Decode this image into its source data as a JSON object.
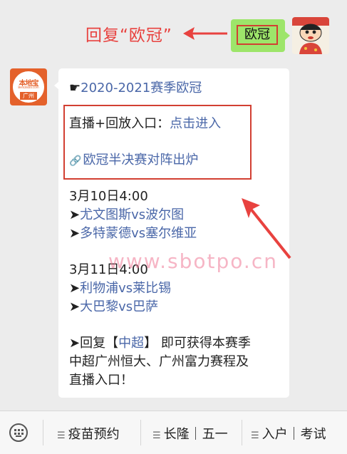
{
  "annotation": {
    "text": "回复“欧冠”"
  },
  "sent_message": {
    "text": "欧冠"
  },
  "bot_avatar": {
    "brand": "本地宝",
    "domain": "BenDiBao.com",
    "city": "广州"
  },
  "message": {
    "title_prefix": "☛",
    "title": "2020-2021赛季欧冠",
    "live_label": "直播+回放入口：",
    "live_link": "点击进入",
    "article_link": "欧冠半决赛对阵出炉",
    "date1": "3月10日4:00",
    "m1_prefix": "➤",
    "match1": "尤文图斯vs波尔图",
    "m2_prefix": "➤",
    "match2": "多特蒙德vs塞尔维亚",
    "date2": "3月11日4:00",
    "m3_prefix": "➤",
    "match3": "利物浦vs莱比锡",
    "m4_prefix": "➤",
    "match4": "大巴黎vs巴萨",
    "reply_prefix": "➤回复",
    "reply_open": "【",
    "reply_keyword": "中超",
    "reply_close": "】",
    "reply_rest1": " 即可获得本赛季",
    "reply_line2": "中超广州恒大、广州富力赛程及",
    "reply_line3": "直播入口！"
  },
  "watermark": "www.sbotpo.cn",
  "menu": [
    {
      "label": "疫苗预约"
    },
    {
      "label": "长隆｜五一"
    },
    {
      "label": "入户｜考试"
    }
  ],
  "colors": {
    "annotation_red": "#e8423f",
    "bubble_green": "#9de56a",
    "link_blue": "#4a67a8"
  }
}
